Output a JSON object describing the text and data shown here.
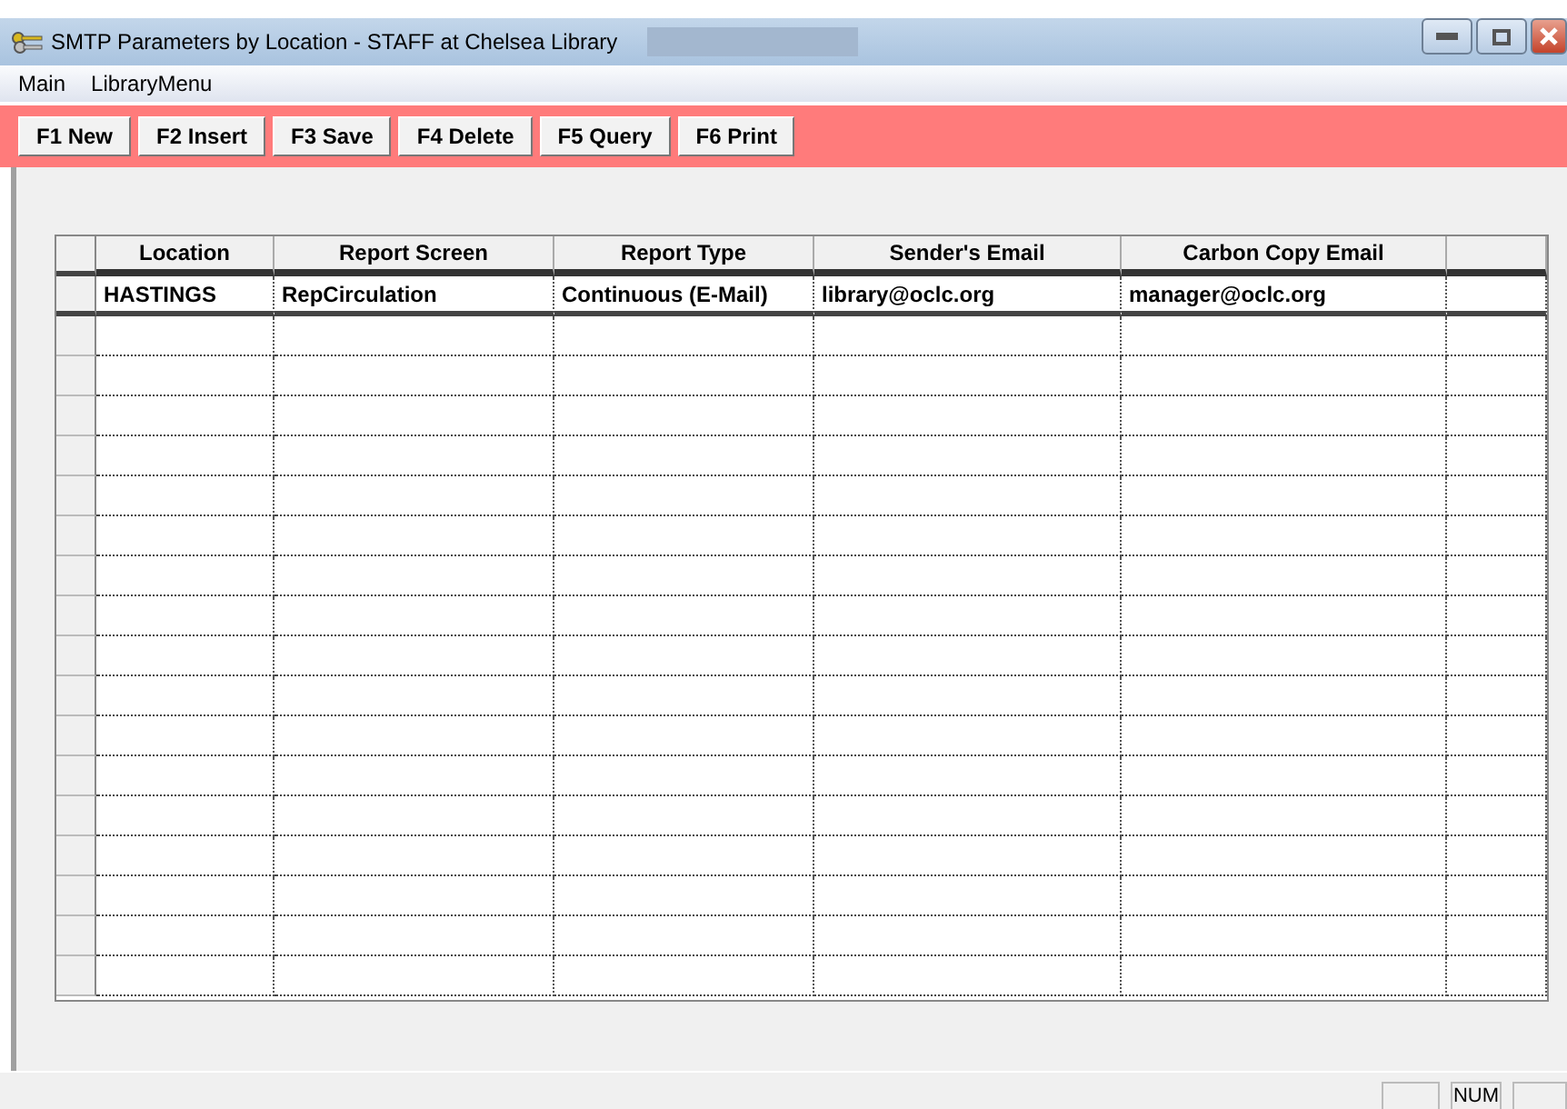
{
  "window": {
    "title": "SMTP Parameters by Location - STAFF at Chelsea Library"
  },
  "menu": [
    "Main",
    "LibraryMenu"
  ],
  "toolbar": [
    "F1 New",
    "F2 Insert",
    "F3 Save",
    "F4 Delete",
    "F5 Query",
    "F6 Print"
  ],
  "table": {
    "columns": [
      "Location",
      "Report Screen",
      "Report Type",
      "Sender's Email",
      "Carbon Copy Email"
    ],
    "rows": [
      [
        "HASTINGS",
        "RepCirculation",
        "Continuous (E-Mail)",
        "library@oclc.org",
        "manager@oclc.org"
      ]
    ]
  },
  "status_bar": {
    "indicator": "NUM"
  }
}
